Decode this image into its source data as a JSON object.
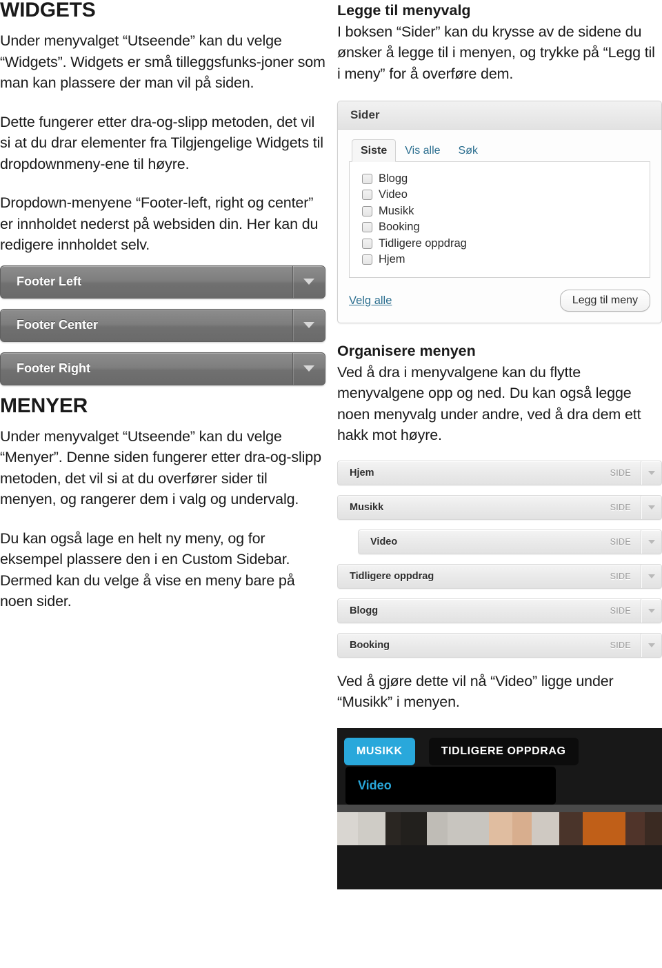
{
  "left": {
    "heading": "WIDGETS",
    "para1": "Under menyvalget “Utseende” kan du velge “Widgets”.  Widgets er små tilleggsfunks-joner som man kan plassere der man vil på siden.",
    "para2": "Dette fungerer etter dra-og-slipp  metoden, det vil si at du drar elementer fra Tilgjengelige Widgets til dropdownmeny-ene til høyre.",
    "para3": "Dropdown-menyene “Footer-left, right og center” er innholdet nederst på websiden din. Her kan du redigere innholdet selv.",
    "widgets": [
      {
        "label": "Footer Left",
        "icon": "chevron-down-icon"
      },
      {
        "label": "Footer Center",
        "icon": "chevron-down-icon"
      },
      {
        "label": "Footer Right",
        "icon": "chevron-down-icon"
      }
    ],
    "heading2": "MENYER",
    "para4": "Under menyvalget “Utseende” kan du velge “Menyer”.  Denne siden fungerer etter dra-og-slipp  metoden, det vil si at du overfører sider til menyen, og rangerer dem i valg og undervalg.",
    "para5": "Du kan også lage en helt ny meny, og for eksempel plassere den i en Custom Sidebar. Dermed kan du velge å vise en meny bare på noen sider."
  },
  "right": {
    "heading1": "Legge til menyvalg",
    "para1": "I boksen “Sider” kan du krysse av de sidene du ønsker å legge til i menyen, og trykke på “Legg til i meny” for å overføre dem.",
    "sider_panel": {
      "title": "Sider",
      "tabs": [
        {
          "label": "Siste",
          "active": true
        },
        {
          "label": "Vis alle",
          "active": false
        },
        {
          "label": "Søk",
          "active": false
        }
      ],
      "pages": [
        {
          "label": "Blogg",
          "checked": false
        },
        {
          "label": "Video",
          "checked": false
        },
        {
          "label": "Musikk",
          "checked": false
        },
        {
          "label": "Booking",
          "checked": false
        },
        {
          "label": "Tidligere oppdrag",
          "checked": false
        },
        {
          "label": "Hjem",
          "checked": false
        }
      ],
      "select_all_link": "Velg alle",
      "add_button": "Legg til meny"
    },
    "heading2": "Organisere menyen",
    "para2": "Ved å dra i menyvalgene kan du flytte menyvalgene opp og ned. Du kan også legge noen menyvalg under andre, ved å dra dem ett hakk mot høyre.",
    "menu_items": [
      {
        "label": "Hjem",
        "type": "SIDE",
        "indent": false
      },
      {
        "label": "Musikk",
        "type": "SIDE",
        "indent": false
      },
      {
        "label": "Video",
        "type": "SIDE",
        "indent": true
      },
      {
        "label": "Tidligere oppdrag",
        "type": "SIDE",
        "indent": false
      },
      {
        "label": "Blogg",
        "type": "SIDE",
        "indent": false
      },
      {
        "label": "Booking",
        "type": "SIDE",
        "indent": false
      }
    ],
    "para3": "Ved å gjøre dette vil nå “Video” ligge under “Musikk” i menyen.",
    "sitenav": {
      "items": [
        {
          "label": "MUSIKK",
          "active": true
        },
        {
          "label": "TIDLIGERE OPPDRAG",
          "active": false
        }
      ],
      "dropdown_item": "Video",
      "accent_color": "#29a8db",
      "background_color": "#181818"
    }
  }
}
